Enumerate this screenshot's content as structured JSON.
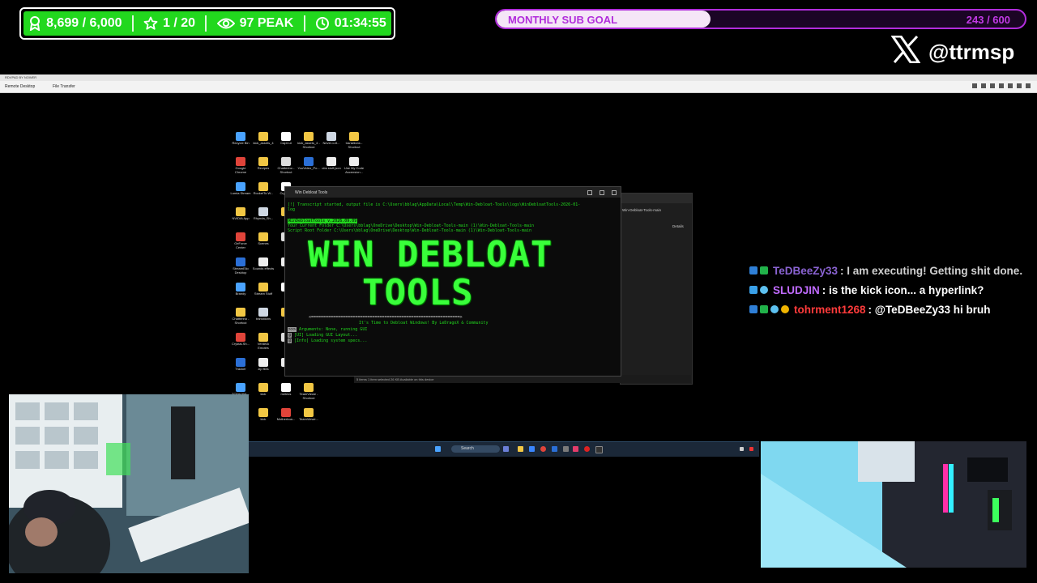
{
  "stats": {
    "followers": "8,699 / 6,000",
    "subs": "1 / 20",
    "peak": "97 PEAK",
    "timer": "01:34:55"
  },
  "sub_goal": {
    "label": "MONTHLY SUB GOAL",
    "value": "243 / 600",
    "progress": 0.405
  },
  "social": {
    "handle": "@ttrmsp"
  },
  "remote_desktop": {
    "title": "RDVPAD BY NOWER",
    "tab_remote": "Remote Desktop",
    "tab_transfer": "File Transfer"
  },
  "desktop_icons": [
    "Recycle Bin",
    "kick_assets_4",
    "CapCut",
    "kick_assets_4 - Shortcut",
    "Never-Let...",
    "transitions - Shortcut",
    "Google Chrome",
    "Recipes",
    "Chatterino - Shortcut",
    "YouVideo_Po...",
    "obs stuff.json",
    "Use My Code Ascension...",
    "Lumia Stream",
    "RocketTo.W...",
    "Crypto...",
    "NVIDIA App",
    "Rhynda_Sh...",
    "",
    "GeForce Center",
    "Scenes",
    "",
    "StreamElio Desktop",
    "Sounds effects",
    "",
    "Brandy",
    "Stream Stuff",
    "",
    "Chatterino - Shortcut",
    "transitions",
    "",
    "Crystal-Sh...",
    "Verdeck Emotes",
    "",
    "Tracker",
    "zip files",
    "",
    "ZOTACBA...",
    "kick",
    "metrics",
    "TeamViewe - Shortcut",
    "Brands - Shortcut",
    "kick",
    "Motherboa...",
    "TeamViewe..."
  ],
  "terminal": {
    "title": "Win Debloat Tools",
    "line1": "[!] Transcript started, output file is C:\\Users\\bblag\\AppData\\Local\\Temp\\Win-Debloat-Tools\\logs\\WinDebloatTools-2026-01-",
    "line2": "log",
    "version": "WinDebloatTools v.2026.09.09",
    "cur_folder": "Your Current Folder C:\\Users\\bblag\\OneDrive\\Desktop\\Win-Debloat-Tools-main (1)\\Win-Debloat-Tools-main",
    "root_folder": "Script Root Folder C:\\Users\\bblag\\OneDrive\\Desktop\\Win-Debloat-Tools-main (1)\\Win-Debloat-Tools-main",
    "banner1": "WIN DEBLOAT",
    "banner2": "TOOLS",
    "divider": "<=============================================================>",
    "tagline": "It's Time to Debloat Windows! By LeDragoX & Community",
    "arg_tag": ">>>",
    "arg_text": "Arguments: None, running GUI",
    "ui_tag": "@",
    "ui_text": "[UI]  Loading GUI Layout...",
    "info_tag": "@",
    "info_text": "[Info] Loading system specs..."
  },
  "explorer": {
    "path": "Win-Debloat-Tools-main",
    "details": "Details",
    "status": "5 items   1 item selected   26 KB   Available on this device"
  },
  "taskbar": {
    "search": "Search"
  },
  "chat": [
    {
      "user": "TeDBeeZy33",
      "text": ": I am executing! Getting shit done.",
      "color": "#8a63d2",
      "text_color": "#d0d0d0"
    },
    {
      "user": "SLUDJIN",
      "text": ": is the kick icon... a hyperlink?",
      "color": "#c06bff",
      "text_color": "#ffffff"
    },
    {
      "user": "tohrment1268",
      "text": ": @TeDBeeZy33 hi bruh",
      "color": "#ff3b3b",
      "text_color": "#ffffff"
    }
  ],
  "colors": {
    "accent_green": "#22d81e",
    "goal_purple": "#b12ddb",
    "terminal_green": "#39ff3a"
  }
}
